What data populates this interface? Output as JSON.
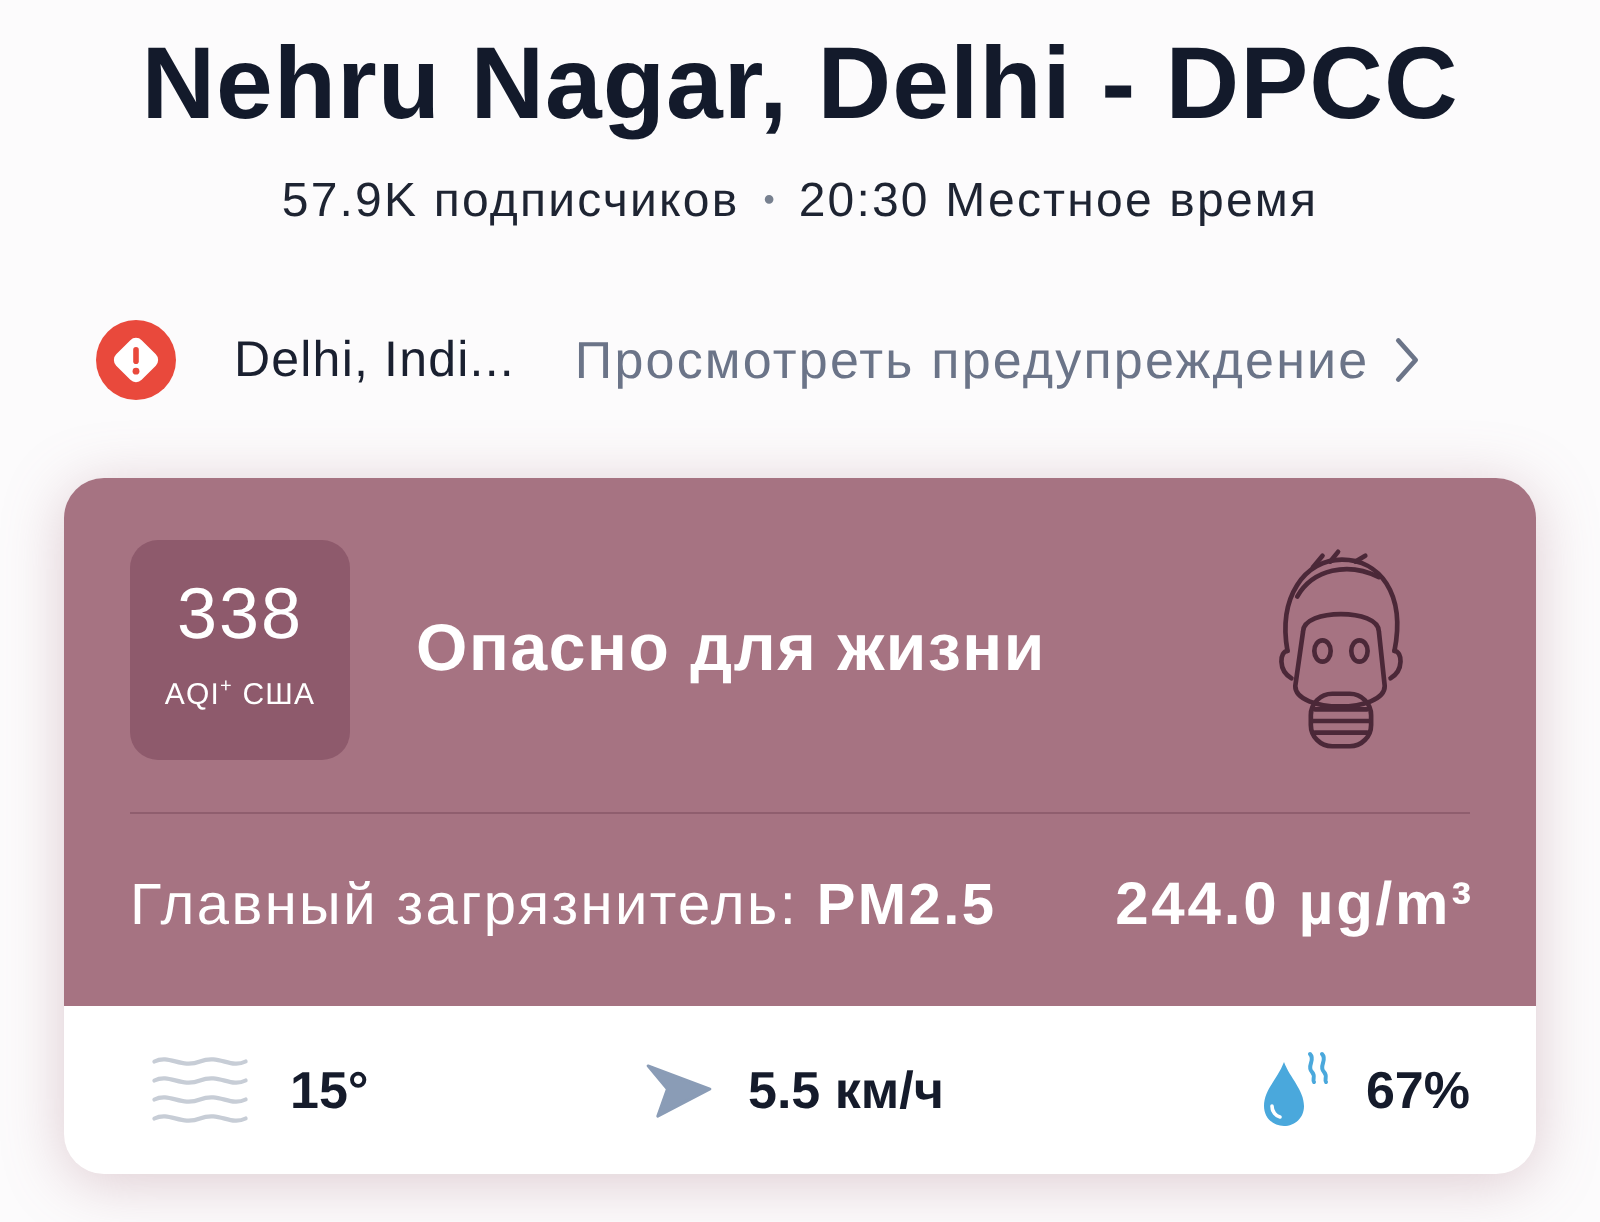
{
  "header": {
    "title": "Nehru Nagar, Delhi - DPCC",
    "followers": "57.9K подписчиков",
    "separator": "•",
    "local_time": "20:30 Местное время"
  },
  "alert": {
    "location": "Delhi, Indi...",
    "link": "Просмотреть предупреждение"
  },
  "aqi_card": {
    "aqi": "338",
    "aqi_label": "AQI$^{+}$ США",
    "status": "Опасно для жизни",
    "pollutant": "Главный загрязнитель: **PM2.5**",
    "concentration": "244.0 µg/m³"
  },
  "weather": [
    {
      "kind": "temperature",
      "value": "15°"
    },
    {
      "kind": "wind",
      "value": "5.5 км/ч"
    },
    {
      "kind": "humidity",
      "value": "67%"
    }
  ]
}
